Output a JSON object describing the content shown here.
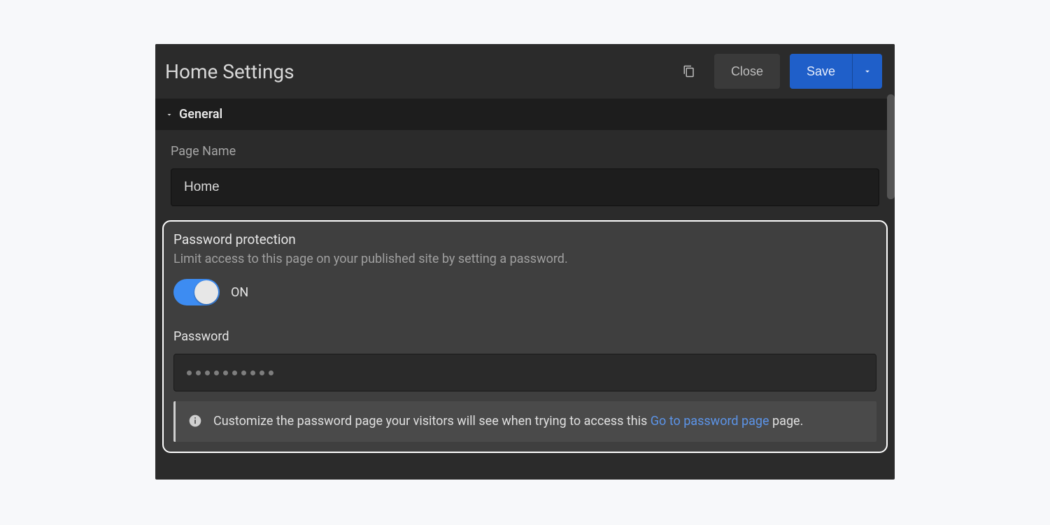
{
  "header": {
    "title": "Home Settings",
    "close_label": "Close",
    "save_label": "Save"
  },
  "section": {
    "general_label": "General",
    "page_name_label": "Page Name",
    "page_name_value": "Home"
  },
  "password_protection": {
    "title": "Password protection",
    "description": "Limit access to this page on your published site by setting a password.",
    "toggle_state": "ON",
    "password_label": "Password",
    "password_dot_count": 10,
    "info_text": "Customize the password page your visitors will see when trying to access this page.",
    "info_link_label": "Go to password page"
  }
}
